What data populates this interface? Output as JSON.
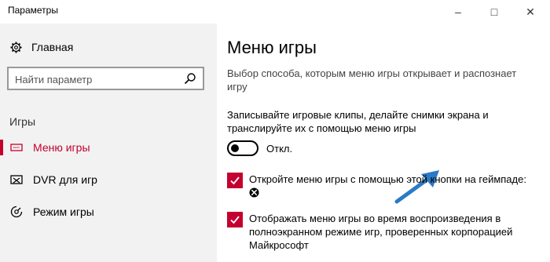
{
  "window": {
    "title": "Параметры",
    "minimize_glyph": "–",
    "maximize_glyph": "□",
    "close_glyph": "✕"
  },
  "sidebar": {
    "home_label": "Главная",
    "home_icon": "gear-icon",
    "search_placeholder": "Найти параметр",
    "search_icon": "search-icon",
    "section_label": "Игры",
    "items": [
      {
        "label": "Меню игры",
        "icon": "game-bar-icon",
        "active": true
      },
      {
        "label": "DVR для игр",
        "icon": "game-dvr-icon",
        "active": false
      },
      {
        "label": "Режим игры",
        "icon": "game-mode-icon",
        "active": false
      }
    ]
  },
  "main": {
    "title": "Меню игры",
    "description": "Выбор способа, которым меню игры открывает и распознает игру",
    "record_label": "Записывайте игровые клипы, делайте снимки экрана и транслируйте их с помощью меню игры",
    "toggle_state": "Откл.",
    "checkbox_open": "Откройте меню игры с помощью этой кнопки на геймпаде:",
    "checkbox_open_icon": "xbox-icon",
    "checkbox_fullscreen": "Отображать меню игры во время воспроизведения в полноэкранном режиме игр, проверенных корпорацией Майкрософт"
  },
  "colors": {
    "accent": "#c3002f",
    "sidebar_bg": "#f2f2f2",
    "arrow": "#2a7ac7"
  }
}
